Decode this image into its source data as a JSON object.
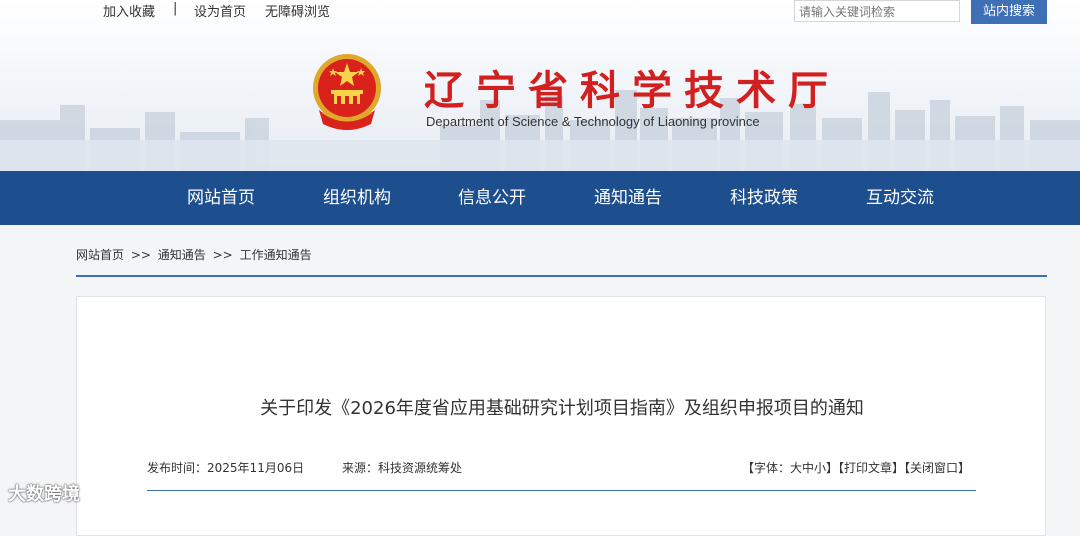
{
  "toplinks": {
    "favorite": "加入收藏",
    "separator": "|",
    "homepage": "设为首页",
    "accessible": "无障碍浏览"
  },
  "search": {
    "placeholder": "请输入关键词检索",
    "button": "站内搜索"
  },
  "site": {
    "title": "辽宁省科学技术厅",
    "subtitle": "Department of Science & Technology of Liaoning province"
  },
  "nav": [
    "网站首页",
    "组织机构",
    "信息公开",
    "通知通告",
    "科技政策",
    "互动交流"
  ],
  "breadcrumb": {
    "items": [
      "网站首页",
      "通知通告",
      "工作通知通告"
    ],
    "separator": ">>"
  },
  "article": {
    "title": "关于印发《2026年度省应用基础研究计划项目指南》及组织申报项目的通知",
    "date_label": "发布时间：",
    "date": "2025年11月06日",
    "source_label": "来源：",
    "source": "科技资源统筹处",
    "tools": "【字体：大中小】【打印文章】【关闭窗口】"
  },
  "watermark": "大数跨境",
  "colors": {
    "nav_bg": "#1d4f8f",
    "title_red": "#d21f1f",
    "accent_blue": "#3f6fb5"
  }
}
